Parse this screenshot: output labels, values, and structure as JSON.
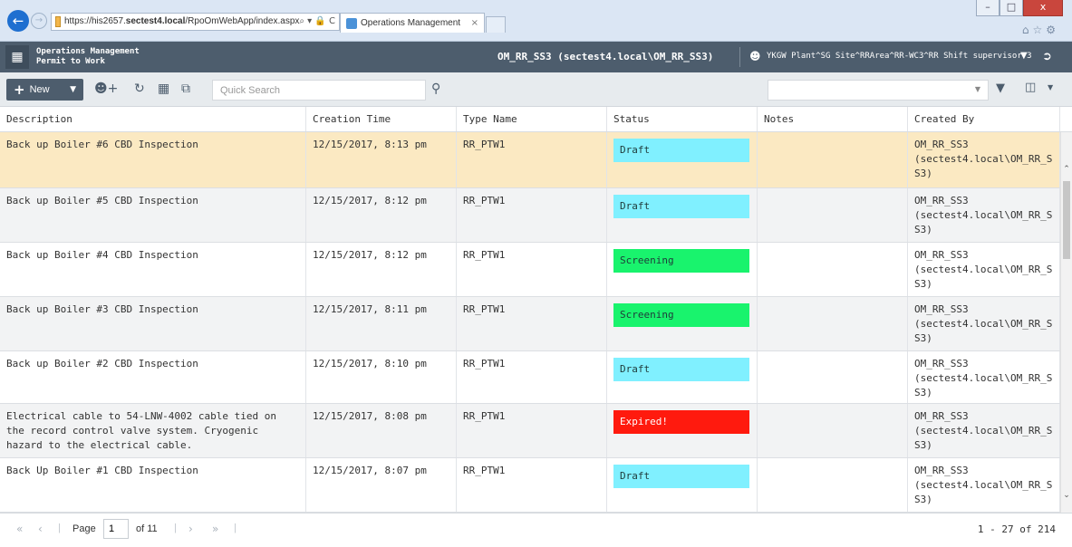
{
  "browser": {
    "url_prefix": "https://his2657.",
    "url_domain": "sectest4.local",
    "url_path": "/RpoOmWebApp/index.aspx",
    "url_icons": "⌕ ▾ 🔒 C",
    "tab_title": "Operations Management",
    "tab_close": "×",
    "min": "–",
    "max": "□",
    "close": "x",
    "tools": "⌂☆⚙"
  },
  "header": {
    "app_name": "Operations Management",
    "module": "Permit to Work",
    "user": "OM_RR_SS3 (sectest4.local\\OM_RR_SS3)",
    "role": "YKGW Plant^SG Site^RRArea^RR-WC3^RR Shift supervisor 3"
  },
  "toolbar": {
    "new_label": "New",
    "search_placeholder": "Quick Search"
  },
  "columns": {
    "description": "Description",
    "creation_time": "Creation Time",
    "type_name": "Type Name",
    "status": "Status",
    "notes": "Notes",
    "created_by": "Created By"
  },
  "rows": [
    {
      "description": "Back up Boiler #6 CBD Inspection",
      "time": "12/15/2017, 8:13 pm",
      "type": "RR_PTW1",
      "status": "Draft",
      "notes": "",
      "by": "OM_RR_SS3 (sectest4.local\\OM_RR_S S3)"
    },
    {
      "description": "Back up Boiler #5 CBD Inspection",
      "time": "12/15/2017, 8:12 pm",
      "type": "RR_PTW1",
      "status": "Draft",
      "notes": "",
      "by": "OM_RR_SS3 (sectest4.local\\OM_RR_S S3)"
    },
    {
      "description": "Back up Boiler #4 CBD Inspection",
      "time": "12/15/2017, 8:12 pm",
      "type": "RR_PTW1",
      "status": "Screening",
      "notes": "",
      "by": "OM_RR_SS3 (sectest4.local\\OM_RR_S S3)"
    },
    {
      "description": "Back up Boiler #3 CBD Inspection",
      "time": "12/15/2017, 8:11 pm",
      "type": "RR_PTW1",
      "status": "Screening",
      "notes": "",
      "by": "OM_RR_SS3 (sectest4.local\\OM_RR_S S3)"
    },
    {
      "description": "Back up Boiler #2 CBD Inspection",
      "time": "12/15/2017, 8:10 pm",
      "type": "RR_PTW1",
      "status": "Draft",
      "notes": "",
      "by": "OM_RR_SS3 (sectest4.local\\OM_RR_S S3)"
    },
    {
      "description": "Electrical cable to 54-LNW-4002 cable tied on the record control valve system. Cryogenic hazard to the electrical cable.",
      "time": "12/15/2017, 8:08 pm",
      "type": "RR_PTW1",
      "status": "Expired!",
      "notes": "",
      "by": "OM_RR_SS3 (sectest4.local\\OM_RR_S S3)"
    },
    {
      "description": "Back Up Boiler #1 CBD Inspection",
      "time": "12/15/2017, 8:07 pm",
      "type": "RR_PTW1",
      "status": "Draft",
      "notes": "",
      "by": "OM_RR_SS3 (sectest4.local\\OM_RR_S S3)"
    }
  ],
  "status_colors": {
    "Draft": "#80f0ff",
    "Screening": "#19f36d",
    "Expired!": "#ff1a0e"
  },
  "pager": {
    "first": "«",
    "prev": "‹",
    "next": "›",
    "last": "»",
    "page_label": "Page",
    "page_value": "1",
    "of_label": "of 11",
    "summary": "1 - 27 of 214"
  },
  "icons": [
    "apps-grid-icon",
    "logout-icon",
    "user-icon",
    "add-user-icon",
    "refresh-icon",
    "excel-export-icon",
    "copy-icon",
    "search-icon",
    "filter-icon",
    "columns-icon"
  ]
}
